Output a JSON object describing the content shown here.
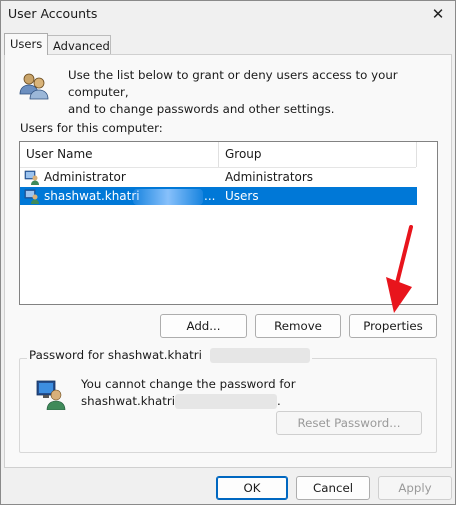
{
  "window": {
    "title": "User Accounts",
    "close_glyph": "✕"
  },
  "tabs": [
    {
      "label": "Users"
    },
    {
      "label": "Advanced"
    }
  ],
  "intro": {
    "line1": "Use the list below to grant or deny users access to your computer,",
    "line2": "and to change passwords and other settings."
  },
  "users_list": {
    "label": "Users for this computer:",
    "columns": [
      "User Name",
      "Group"
    ],
    "rows": [
      {
        "name": "Administrator",
        "group": "Administrators",
        "selected": false
      },
      {
        "name": "shashwat.khatri",
        "name_suffix": "...",
        "group": "Users",
        "selected": true
      }
    ]
  },
  "buttons": {
    "add": "Add...",
    "remove": "Remove",
    "properties": "Properties",
    "reset_password": "Reset Password...",
    "ok": "OK",
    "cancel": "Cancel",
    "apply": "Apply"
  },
  "password_group": {
    "label": "Password for shashwat.khatri",
    "message_line1": "You cannot change the password for",
    "message_line2_prefix": "shashwat.khatri",
    "message_line2_suffix": "."
  },
  "colors": {
    "selection": "#0078d7",
    "arrow": "#e8141c",
    "accent": "#0067c0"
  }
}
